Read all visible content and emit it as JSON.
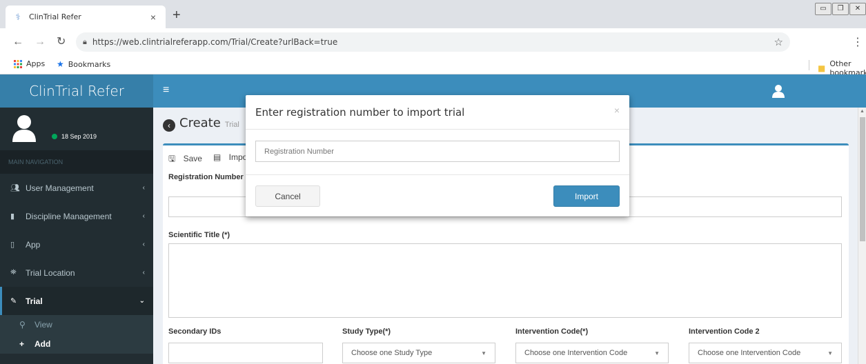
{
  "browser": {
    "tab_title": "ClinTrial Refer",
    "tab_close": "×",
    "new_tab": "+",
    "url": "https://web.clintrialreferapp.com/Trial/Create?urlBack=true",
    "bookmarks": [
      {
        "label": "Apps"
      },
      {
        "label": "Bookmarks"
      }
    ],
    "other_bookmarks": "Other bookmarks"
  },
  "app": {
    "logo": "ClinTrial Refer",
    "brand_color": "#3c8dbc"
  },
  "sidebar": {
    "user_date": "18 Sep 2019",
    "nav_header": "MAIN NAVIGATION",
    "items": [
      {
        "label": "User Management",
        "icon": "users-icon"
      },
      {
        "label": "Discipline Management",
        "icon": "trash-icon"
      },
      {
        "label": "App",
        "icon": "tablet-icon"
      },
      {
        "label": "Trial Location",
        "icon": "map-icon"
      },
      {
        "label": "Trial",
        "icon": "pencil-icon"
      }
    ],
    "sub_items": [
      {
        "label": "View",
        "icon": "search-icon"
      },
      {
        "label": "Add",
        "icon": "plus-icon"
      }
    ]
  },
  "content": {
    "title": "Create",
    "subtitle": "Trial",
    "toolbar": {
      "save_label": "Save",
      "import_label": "Import"
    },
    "fields": {
      "registration_number": "Registration Number",
      "scientific_title": "Scientific Title (*)",
      "secondary_ids": "Secondary IDs",
      "study_type": "Study Type(*)",
      "intervention_code": "Intervention Code(*)",
      "intervention_code_2": "Intervention Code 2"
    },
    "selects": {
      "study_type": "Choose one Study Type",
      "intervention_code": "Choose one Intervention Code",
      "intervention_code_2": "Choose one Intervention Code"
    }
  },
  "modal": {
    "title": "Enter registration number to import trial",
    "close": "×",
    "input_placeholder": "Registration Number",
    "cancel_label": "Cancel",
    "import_label": "Import"
  }
}
